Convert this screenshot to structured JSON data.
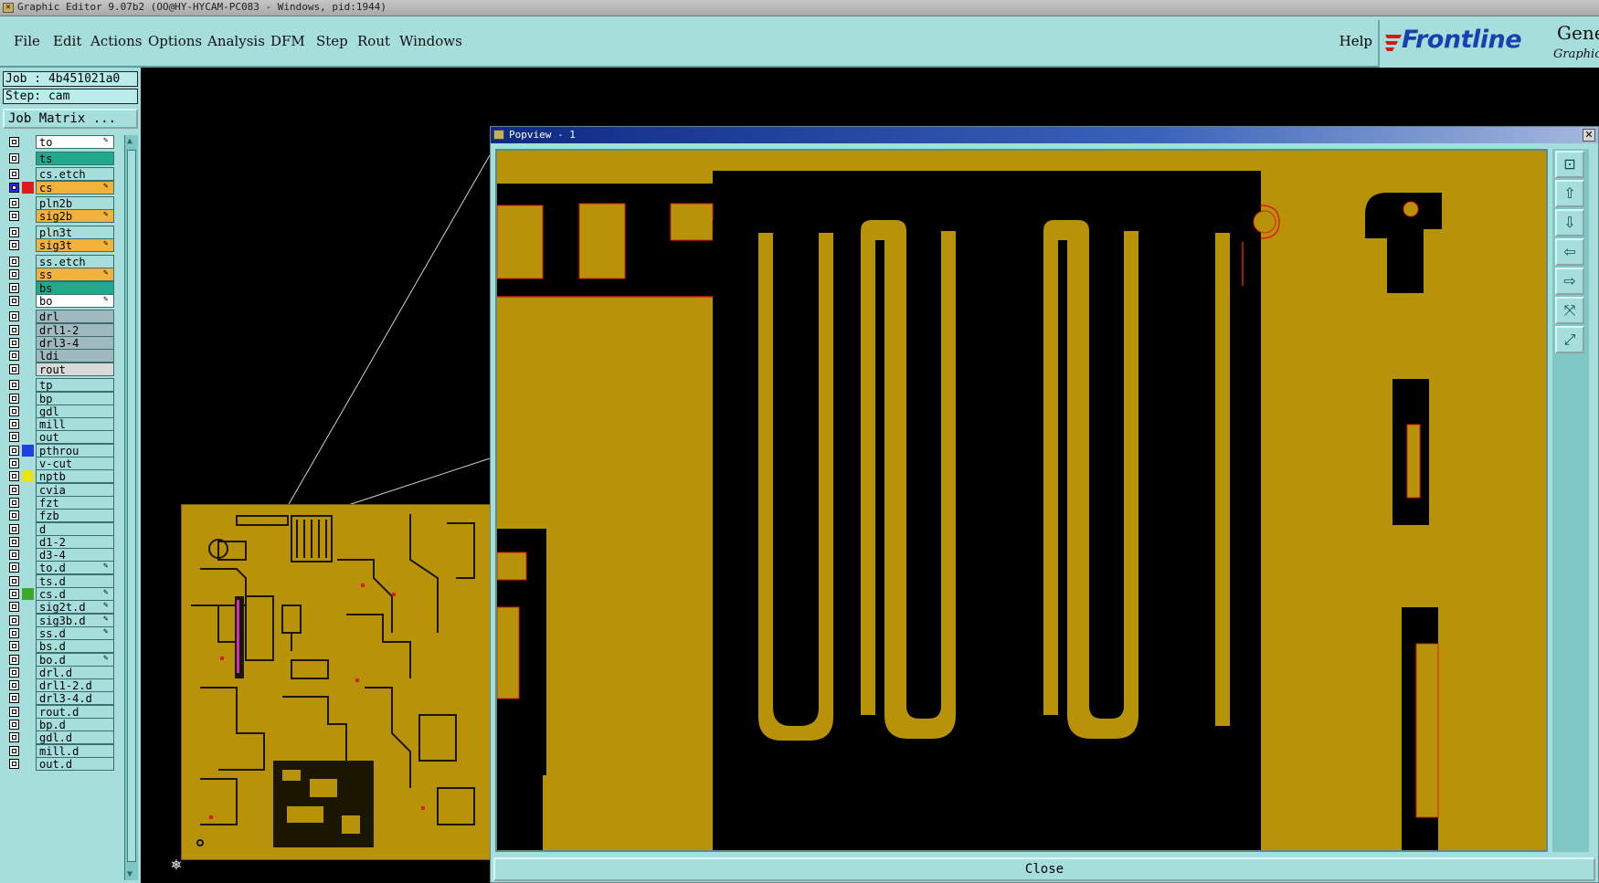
{
  "window": {
    "title": "Graphic Editor 9.07b2 (OO@HY-HYCAM-PC083 - Windows, pid:1944)"
  },
  "menu": {
    "items": [
      {
        "label": "File"
      },
      {
        "label": "Edit"
      },
      {
        "label": "Actions"
      },
      {
        "label": "Options"
      },
      {
        "label": "Analysis"
      },
      {
        "label": "DFM"
      },
      {
        "label": "Step"
      },
      {
        "label": "Rout"
      },
      {
        "label": "Windows"
      }
    ],
    "help": "Help"
  },
  "logo": {
    "brand": "Frontline",
    "product": "Genesis",
    "subtitle": "Graphic"
  },
  "job": {
    "job_text": "Job : 4b451021a0",
    "step_text": "Step: cam",
    "matrix_button": "Job Matrix ..."
  },
  "layers": [
    {
      "name": "to",
      "bg": "#ffffff",
      "swatch": "",
      "checked": false,
      "pen": true
    },
    {
      "name": "ts",
      "bg": "#21a98d",
      "swatch": "",
      "checked": false,
      "pen": false
    },
    {
      "name": "cs.etch",
      "bg": "#a6dedc",
      "swatch": "",
      "checked": false,
      "pen": false
    },
    {
      "name": "cs",
      "bg": "#f3b23a",
      "swatch": "#e01b1b",
      "checked": true,
      "pen": true
    },
    {
      "name": "pln2b",
      "bg": "#a6dedc",
      "swatch": "",
      "checked": false,
      "pen": false
    },
    {
      "name": "sig2b",
      "bg": "#f3b23a",
      "swatch": "",
      "checked": false,
      "pen": true
    },
    {
      "name": "pln3t",
      "bg": "#a6dedc",
      "swatch": "",
      "checked": false,
      "pen": false
    },
    {
      "name": "sig3t",
      "bg": "#f3b23a",
      "swatch": "",
      "checked": false,
      "pen": true
    },
    {
      "name": "ss.etch",
      "bg": "#a6dedc",
      "swatch": "",
      "checked": false,
      "pen": false
    },
    {
      "name": "ss",
      "bg": "#f3b23a",
      "swatch": "",
      "checked": false,
      "pen": true
    },
    {
      "name": "bs",
      "bg": "#21a98d",
      "swatch": "",
      "checked": false,
      "pen": false
    },
    {
      "name": "bo",
      "bg": "#ffffff",
      "swatch": "",
      "checked": false,
      "pen": true
    },
    {
      "name": "drl",
      "bg": "#9fb9bf",
      "swatch": "",
      "checked": false,
      "pen": false
    },
    {
      "name": "drl1-2",
      "bg": "#9fb9bf",
      "swatch": "",
      "checked": false,
      "pen": false
    },
    {
      "name": "drl3-4",
      "bg": "#9fb9bf",
      "swatch": "",
      "checked": false,
      "pen": false
    },
    {
      "name": "ldi",
      "bg": "#9fb9bf",
      "swatch": "",
      "checked": false,
      "pen": false
    },
    {
      "name": "rout",
      "bg": "#d9d9d9",
      "swatch": "",
      "checked": false,
      "pen": false
    },
    {
      "name": "tp",
      "bg": "#a6dedc",
      "swatch": "",
      "checked": false,
      "pen": false
    },
    {
      "name": "bp",
      "bg": "#a6dedc",
      "swatch": "",
      "checked": false,
      "pen": false
    },
    {
      "name": "gdl",
      "bg": "#a6dedc",
      "swatch": "",
      "checked": false,
      "pen": false
    },
    {
      "name": "mill",
      "bg": "#a6dedc",
      "swatch": "",
      "checked": false,
      "pen": false
    },
    {
      "name": "out",
      "bg": "#a6dedc",
      "swatch": "",
      "checked": false,
      "pen": false
    },
    {
      "name": "pthrou",
      "bg": "#a6dedc",
      "swatch": "#1f3fe0",
      "checked": false,
      "pen": false
    },
    {
      "name": "v-cut",
      "bg": "#a6dedc",
      "swatch": "",
      "checked": false,
      "pen": false
    },
    {
      "name": "nptb",
      "bg": "#a6dedc",
      "swatch": "#e8e31c",
      "checked": false,
      "pen": false
    },
    {
      "name": "cvia",
      "bg": "#a6dedc",
      "swatch": "",
      "checked": false,
      "pen": false
    },
    {
      "name": "fzt",
      "bg": "#a6dedc",
      "swatch": "",
      "checked": false,
      "pen": false
    },
    {
      "name": "fzb",
      "bg": "#a6dedc",
      "swatch": "",
      "checked": false,
      "pen": false
    },
    {
      "name": "d",
      "bg": "#a6dedc",
      "swatch": "",
      "checked": false,
      "pen": false
    },
    {
      "name": "d1-2",
      "bg": "#a6dedc",
      "swatch": "",
      "checked": false,
      "pen": false
    },
    {
      "name": "d3-4",
      "bg": "#a6dedc",
      "swatch": "",
      "checked": false,
      "pen": false
    },
    {
      "name": "to.d",
      "bg": "#a6dedc",
      "swatch": "",
      "checked": false,
      "pen": true
    },
    {
      "name": "ts.d",
      "bg": "#a6dedc",
      "swatch": "",
      "checked": false,
      "pen": false
    },
    {
      "name": "cs.d",
      "bg": "#a6dedc",
      "swatch": "#3da82b",
      "checked": false,
      "pen": true
    },
    {
      "name": "sig2t.d",
      "bg": "#a6dedc",
      "swatch": "",
      "checked": false,
      "pen": true
    },
    {
      "name": "sig3b.d",
      "bg": "#a6dedc",
      "swatch": "",
      "checked": false,
      "pen": true
    },
    {
      "name": "ss.d",
      "bg": "#a6dedc",
      "swatch": "",
      "checked": false,
      "pen": true
    },
    {
      "name": "bs.d",
      "bg": "#a6dedc",
      "swatch": "",
      "checked": false,
      "pen": false
    },
    {
      "name": "bo.d",
      "bg": "#a6dedc",
      "swatch": "",
      "checked": false,
      "pen": true
    },
    {
      "name": "drl.d",
      "bg": "#a6dedc",
      "swatch": "",
      "checked": false,
      "pen": false
    },
    {
      "name": "drl1-2.d",
      "bg": "#a6dedc",
      "swatch": "",
      "checked": false,
      "pen": false
    },
    {
      "name": "drl3-4.d",
      "bg": "#a6dedc",
      "swatch": "",
      "checked": false,
      "pen": false
    },
    {
      "name": "rout.d",
      "bg": "#a6dedc",
      "swatch": "",
      "checked": false,
      "pen": false
    },
    {
      "name": "bp.d",
      "bg": "#a6dedc",
      "swatch": "",
      "checked": false,
      "pen": false
    },
    {
      "name": "gdl.d",
      "bg": "#a6dedc",
      "swatch": "",
      "checked": false,
      "pen": false
    },
    {
      "name": "mill.d",
      "bg": "#a6dedc",
      "swatch": "",
      "checked": false,
      "pen": false
    },
    {
      "name": "out.d",
      "bg": "#a6dedc",
      "swatch": "",
      "checked": false,
      "pen": false
    }
  ],
  "popview": {
    "title": "Popview - 1",
    "close_label": "Close",
    "tools": [
      "zoom-fit-icon",
      "pan-up-icon",
      "pan-down-icon",
      "pan-left-icon",
      "pan-right-icon",
      "zoom-in-icon",
      "zoom-out-icon"
    ]
  },
  "colors": {
    "copper": "#b8930a",
    "panel": "#a6dedc",
    "highlight": "#e01b1b"
  }
}
